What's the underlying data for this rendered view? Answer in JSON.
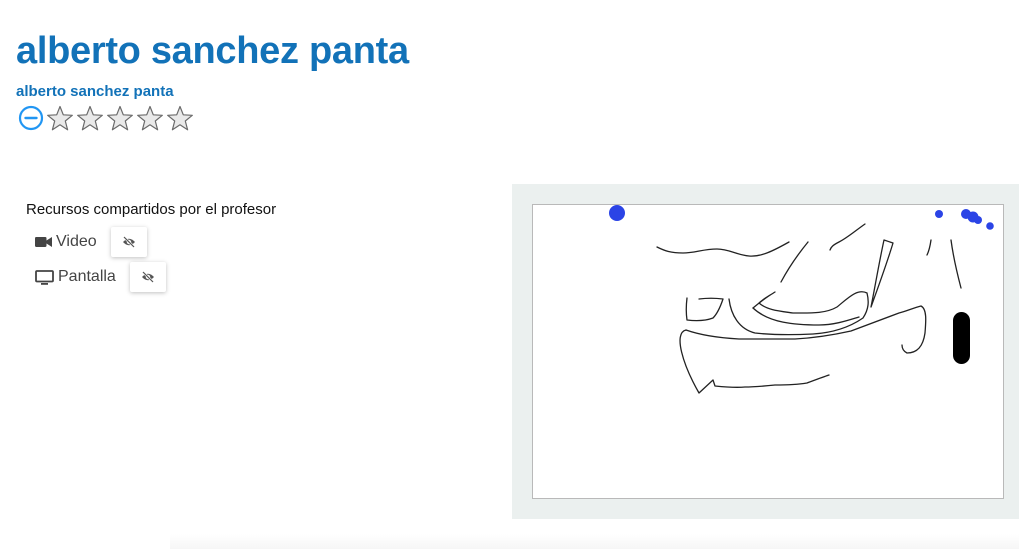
{
  "header": {
    "title": "alberto sanchez panta",
    "subtitle": "alberto sanchez panta"
  },
  "rating": {
    "value": 0,
    "max": 5,
    "remove_icon": "minus-circle-icon",
    "star_icon": "star-outline-icon"
  },
  "resources": {
    "heading": "Recursos compartidos por el profesor",
    "items": [
      {
        "label": "Video",
        "icon": "video-camera-icon",
        "toggle_icon": "eye-off-icon"
      },
      {
        "label": "Pantalla",
        "icon": "monitor-icon",
        "toggle_icon": "eye-off-icon"
      }
    ]
  },
  "whiteboard": {
    "ink_color": "#222222",
    "marker_color": "#2b44e6",
    "panel_color": "#ebf0ef"
  },
  "colors": {
    "brand": "#1272b8",
    "accent": "#2196f3"
  }
}
